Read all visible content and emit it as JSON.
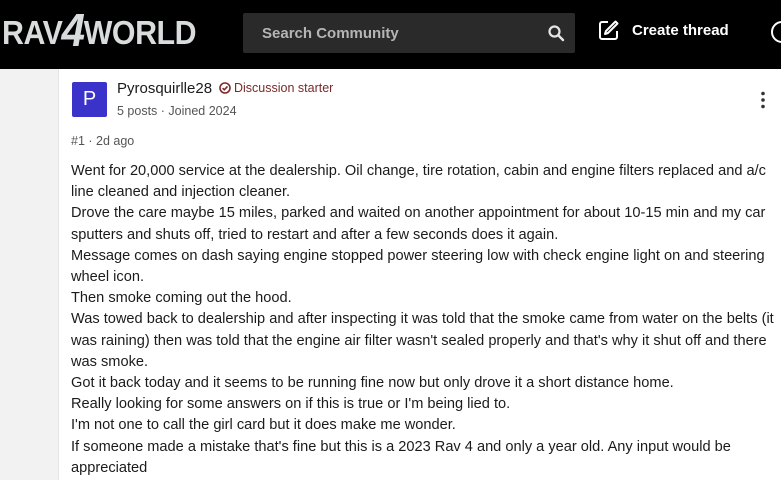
{
  "header": {
    "logo_left": "RAV",
    "logo_four": "4",
    "logo_right": "WORLD",
    "search_placeholder": "Search Community",
    "create_thread_label": "Create thread"
  },
  "post": {
    "avatar_letter": "P",
    "username": "Pyrosquirlle28",
    "badge": "Discussion starter",
    "meta": "5 posts · Joined 2024",
    "post_number": "#1 · 2d ago",
    "paragraphs": [
      "Went for 20,000 service at the dealership. Oil change, tire rotation, cabin and engine filters replaced and a/c line cleaned and injection cleaner.",
      "Drove the care maybe 15 miles, parked and waited on another appointment for about 10-15 min and my car sputters and shuts off, tried to restart and after a few seconds does it again.",
      "Message comes on dash saying engine stopped power steering low with check engine light on and steering wheel icon.",
      "Then smoke coming out the hood.",
      "Was towed back to dealership and after inspecting it was told that the smoke came from water on the belts (it was raining) then was told that the engine air filter wasn't sealed properly and that's why it shut off and there was smoke.",
      "Got it back today and it seems to be running fine now but only drove it a short distance home.",
      "Really looking for some answers on if this is true or I'm being lied to.",
      "I'm not one to call the girl card but it does make me wonder.",
      "If someone made a mistake that's fine but this is a 2023 Rav 4 and only a year old. Any input would be appreciated"
    ]
  },
  "colors": {
    "header_bg": "#000000",
    "avatar_bg": "#3b32c9",
    "badge_color": "#7a2a2a"
  }
}
